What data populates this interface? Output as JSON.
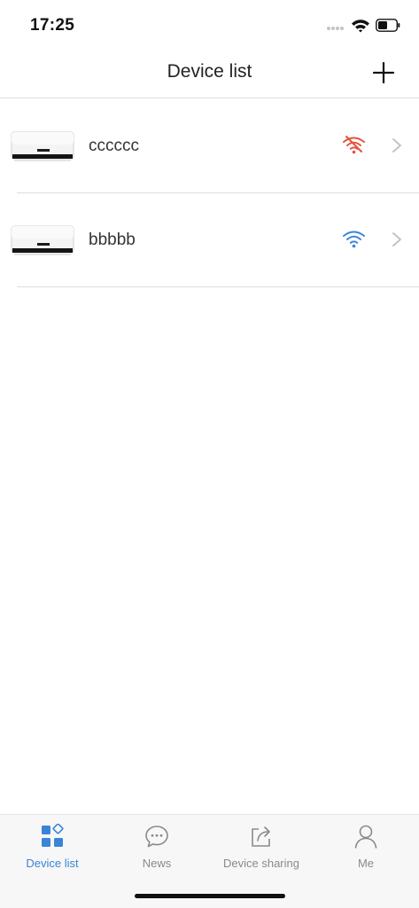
{
  "status_bar": {
    "time": "17:25",
    "icons": [
      "signal-dots-icon",
      "wifi-icon",
      "battery-icon"
    ]
  },
  "header": {
    "title": "Device list",
    "add_icon": "plus-icon"
  },
  "devices": [
    {
      "name": "cccccc",
      "connection": "offline",
      "wifi_icon": "wifi-off-icon",
      "wifi_color": "#e6533c"
    },
    {
      "name": "bbbbb",
      "connection": "online",
      "wifi_icon": "wifi-icon",
      "wifi_color": "#3a84d8"
    }
  ],
  "tab_bar": {
    "tabs": [
      {
        "label": "Device list",
        "icon": "device-grid-icon",
        "active": true
      },
      {
        "label": "News",
        "icon": "chat-bubble-icon",
        "active": false
      },
      {
        "label": "Device sharing",
        "icon": "share-icon",
        "active": false
      },
      {
        "label": "Me",
        "icon": "person-icon",
        "active": false
      }
    ]
  },
  "colors": {
    "accent": "#3a84d8",
    "offline": "#e6533c",
    "inactive": "#8a8a8a",
    "divider": "#dedede",
    "tab_bar_bg": "#f7f7f7"
  }
}
